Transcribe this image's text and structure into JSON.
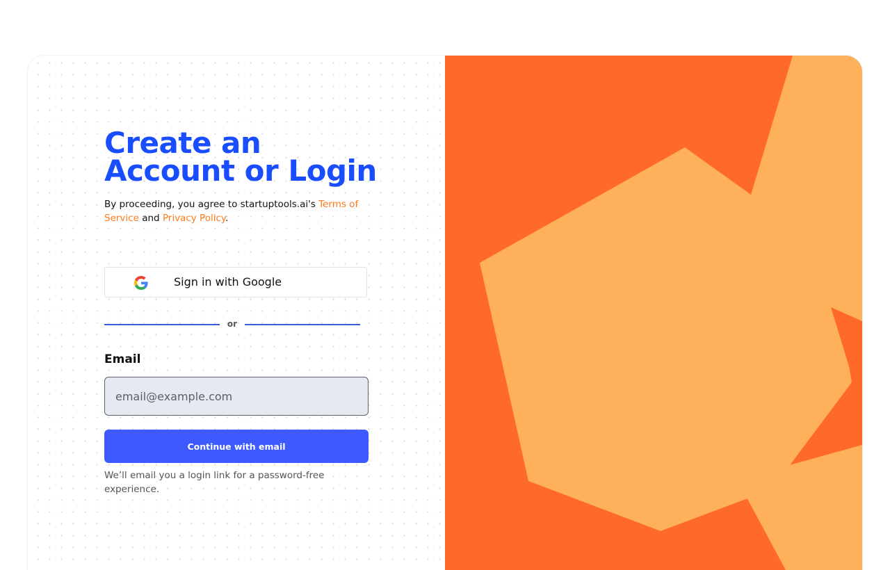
{
  "heading": {
    "line1": "Create an",
    "line2": "Account or Login"
  },
  "terms": {
    "prefix": "By proceeding, you agree to startuptools.ai's ",
    "terms_link": "Terms of Service",
    "middle": " and ",
    "privacy_link": "Privacy Policy",
    "suffix": "."
  },
  "google_button": {
    "label": "Sign in with Google",
    "icon": "google-g-icon"
  },
  "divider": {
    "label": "or"
  },
  "email": {
    "label": "Email",
    "value": "",
    "placeholder": "email@example.com"
  },
  "continue_button": {
    "label": "Continue with email"
  },
  "helper_text": "We’ll email you a login link for a password-free experience.",
  "colors": {
    "heading": "#1a4dff",
    "link": "#ff7a1a",
    "primary_button": "#3d5afe",
    "divider": "#3a5bd9",
    "art_background": "#ff6a28",
    "art_shape": "#ffb05a"
  }
}
